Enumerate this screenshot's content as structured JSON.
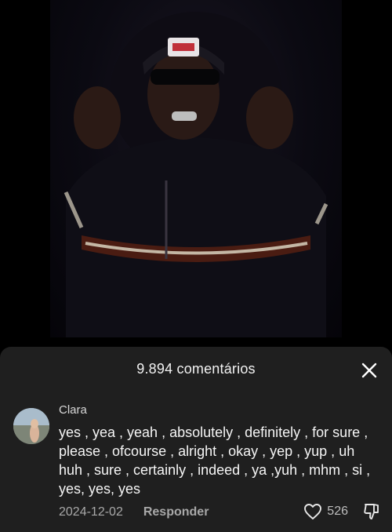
{
  "comments_panel": {
    "title": "9.894 comentários",
    "comment": {
      "username": "Clara",
      "text": "yes , yea , yeah , absolutely , definitely , for sure , please , ofcourse , alright , okay , yep , yup , uh huh , sure , certainly , indeed , ya ,yuh , mhm , si , yes, yes, yes",
      "date": "2024-12-02",
      "reply_label": "Responder",
      "like_count": "526"
    }
  },
  "colors": {
    "sheet_background": "#1f1f1f",
    "video_background": "#000000",
    "primary_text": "#f5f5f5",
    "secondary_text": "#a8a8a8"
  },
  "icons": {
    "close": "close-icon",
    "like": "heart-icon",
    "dislike": "thumbs-down-icon"
  }
}
